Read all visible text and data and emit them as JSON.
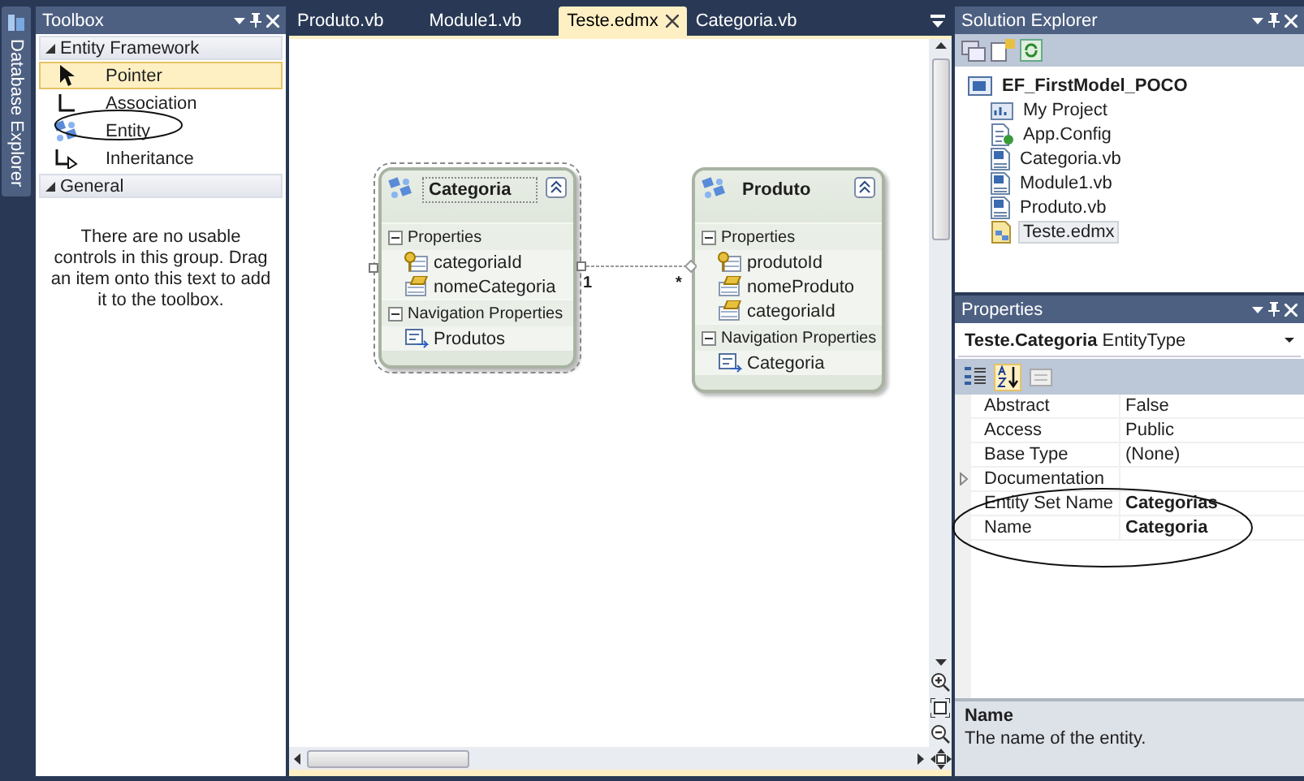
{
  "side_tab": {
    "label": "Database Explorer"
  },
  "toolbox": {
    "title": "Toolbox",
    "groups": [
      {
        "label": "Entity Framework",
        "expanded": true,
        "items": [
          {
            "label": "Pointer",
            "kind": "pointer",
            "selected": true
          },
          {
            "label": "Association",
            "kind": "association",
            "selected": false
          },
          {
            "label": "Entity",
            "kind": "entity",
            "selected": false
          },
          {
            "label": "Inheritance",
            "kind": "inheritance",
            "selected": false
          }
        ]
      },
      {
        "label": "General",
        "expanded": true,
        "empty_text": "There are no usable controls in this group. Drag an item onto this text to add it to the toolbox."
      }
    ]
  },
  "editor": {
    "tabs": [
      {
        "label": "Produto.vb",
        "selected": false
      },
      {
        "label": "Module1.vb",
        "selected": false
      },
      {
        "label": "Teste.edmx",
        "selected": true
      },
      {
        "label": "Categoria.vb",
        "selected": false
      }
    ],
    "entities": [
      {
        "name": "Categoria",
        "selected": true,
        "sections": [
          {
            "label": "Properties",
            "expanded": true,
            "items": [
              {
                "label": "categoriaId",
                "kind": "key"
              },
              {
                "label": "nomeCategoria",
                "kind": "property"
              }
            ]
          },
          {
            "label": "Navigation Properties",
            "expanded": true,
            "items": [
              {
                "label": "Produtos",
                "kind": "navigation"
              }
            ]
          }
        ]
      },
      {
        "name": "Produto",
        "selected": false,
        "sections": [
          {
            "label": "Properties",
            "expanded": true,
            "items": [
              {
                "label": "produtoId",
                "kind": "key"
              },
              {
                "label": "nomeProduto",
                "kind": "property"
              },
              {
                "label": "categoriaId",
                "kind": "property"
              }
            ]
          },
          {
            "label": "Navigation Properties",
            "expanded": true,
            "items": [
              {
                "label": "Categoria",
                "kind": "navigation"
              }
            ]
          }
        ]
      }
    ],
    "association": {
      "source_multiplicity": "1",
      "target_multiplicity": "*"
    }
  },
  "solution_explorer": {
    "title": "Solution Explorer",
    "root": {
      "label": "EF_FirstModel_POCO",
      "children": [
        {
          "label": "My Project",
          "kind": "project",
          "selected": false
        },
        {
          "label": "App.Config",
          "kind": "config",
          "selected": false
        },
        {
          "label": "Categoria.vb",
          "kind": "vb",
          "selected": false
        },
        {
          "label": "Module1.vb",
          "kind": "vb",
          "selected": false
        },
        {
          "label": "Produto.vb",
          "kind": "vb",
          "selected": false
        },
        {
          "label": "Teste.edmx",
          "kind": "edmx",
          "selected": true
        }
      ]
    }
  },
  "properties": {
    "title": "Properties",
    "object": "Teste.Categoria",
    "type": "EntityType",
    "toolbar": [
      {
        "kind": "categorized",
        "selected": false
      },
      {
        "kind": "alphabetical",
        "selected": true
      },
      {
        "kind": "pages",
        "selected": false
      }
    ],
    "rows": [
      {
        "name": "Abstract",
        "value": "False",
        "bold": false,
        "expandable": false
      },
      {
        "name": "Access",
        "value": "Public",
        "bold": false,
        "expandable": false
      },
      {
        "name": "Base Type",
        "value": "(None)",
        "bold": false,
        "expandable": false
      },
      {
        "name": "Documentation",
        "expandable": true
      },
      {
        "name": "Entity Set Name",
        "value": "Categorias",
        "bold": true,
        "expandable": false
      },
      {
        "name": "Name",
        "value": "Categoria",
        "bold": true,
        "expandable": false
      }
    ],
    "description": {
      "title": "Name",
      "text": "The name of the entity."
    }
  }
}
